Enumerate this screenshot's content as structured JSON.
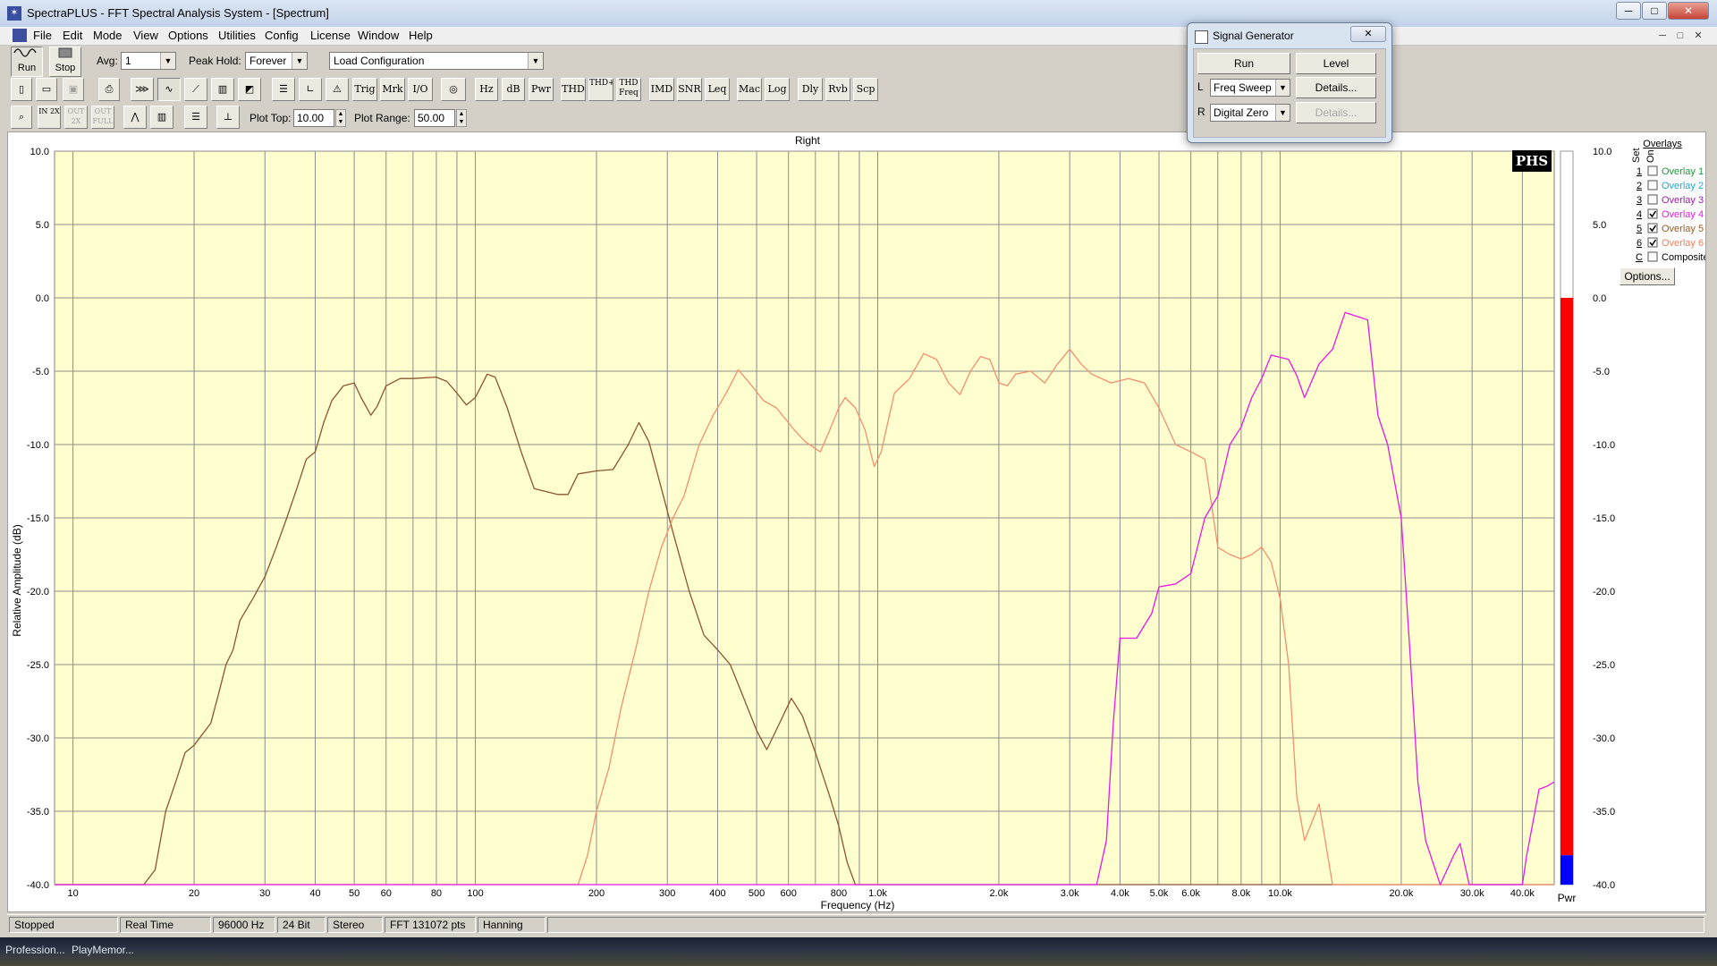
{
  "window": {
    "title": "SpectraPLUS - FFT Spectral Analysis System - [Spectrum]",
    "minimize_glyph": "─",
    "maximize_glyph": "□",
    "close_glyph": "✕"
  },
  "menu": {
    "items": [
      "File",
      "Edit",
      "Mode",
      "View",
      "Options",
      "Utilities",
      "Config",
      "License",
      "Window",
      "Help"
    ]
  },
  "toolbar1": {
    "run_label": "Run",
    "stop_label": "Stop",
    "avg_label": "Avg:",
    "avg_value": "1",
    "peak_hold_label": "Peak Hold:",
    "peak_hold_value": "Forever",
    "config_value": "Load Configuration"
  },
  "toolbar2": {
    "buttons": [
      "Trig",
      "Mrk",
      "I/O",
      "Hz",
      "dB",
      "Pwr",
      "THD",
      "THD+N",
      "THD Freq",
      "IMD",
      "SNR",
      "Leq",
      "Mac",
      "Log",
      "Dly",
      "Rvb",
      "Scp"
    ]
  },
  "toolbar3": {
    "zoom_in": "IN 2X",
    "zoom_out": "OUT 2X",
    "zoom_full": "OUT FULL",
    "plot_top_label": "Plot Top:",
    "plot_top_value": "10.00",
    "plot_range_label": "Plot Range:",
    "plot_range_value": "50.00"
  },
  "signal_generator": {
    "title": "Signal Generator",
    "close_glyph": "✕",
    "run_label": "Run",
    "level_label": "Level",
    "left_channel_label": "L",
    "left_signal": "Freq Sweep",
    "left_details": "Details...",
    "right_channel_label": "R",
    "right_signal": "Digital Zero",
    "right_details": "Details..."
  },
  "plot": {
    "channel_title": "Right",
    "logo": "PHS",
    "meter_label": "Pwr",
    "meter_level_db": -38.0,
    "meter_colors": {
      "red": "#ff0000",
      "blue": "#0000ff",
      "background": "#ffffff"
    }
  },
  "overlays": {
    "header": "Overlays",
    "set_label": "Set",
    "on_label": "On",
    "items": [
      {
        "key": "1",
        "name": "Overlay 1",
        "checked": false,
        "color": "#1c9a3c"
      },
      {
        "key": "2",
        "name": "Overlay 2",
        "checked": false,
        "color": "#20a7c9"
      },
      {
        "key": "3",
        "name": "Overlay 3",
        "checked": false,
        "color": "#9b1ca8"
      },
      {
        "key": "4",
        "name": "Overlay 4",
        "checked": true,
        "color": "#e619e6"
      },
      {
        "key": "5",
        "name": "Overlay 5",
        "checked": true,
        "color": "#9a5a20"
      },
      {
        "key": "6",
        "name": "Overlay 6",
        "checked": true,
        "color": "#f08058"
      },
      {
        "key": "C",
        "name": "Composite",
        "checked": false,
        "color": "#000000"
      }
    ],
    "options_label": "Options..."
  },
  "status": {
    "cells": [
      "Stopped",
      "Real Time",
      "96000 Hz",
      "24 Bit",
      "Stereo",
      "FFT 131072 pts",
      "Hanning"
    ]
  },
  "taskbar": {
    "items": [
      "Profession...",
      "PlayMemor..."
    ]
  },
  "chart_data": {
    "type": "line",
    "title": "Right",
    "xlabel": "Frequency (Hz)",
    "ylabel": "Relative Amplitude (dB)",
    "x_scale": "log",
    "xlim": [
      9,
      48000
    ],
    "ylim": [
      -40,
      10
    ],
    "grid": true,
    "background": "#fffecf",
    "x_tick_labels": [
      {
        "value": 10,
        "label": "10"
      },
      {
        "value": 20,
        "label": "20"
      },
      {
        "value": 30,
        "label": "30"
      },
      {
        "value": 40,
        "label": "40"
      },
      {
        "value": 50,
        "label": "50"
      },
      {
        "value": 60,
        "label": "60"
      },
      {
        "value": 80,
        "label": "80"
      },
      {
        "value": 100,
        "label": "100"
      },
      {
        "value": 200,
        "label": "200"
      },
      {
        "value": 300,
        "label": "300"
      },
      {
        "value": 400,
        "label": "400"
      },
      {
        "value": 500,
        "label": "500"
      },
      {
        "value": 600,
        "label": "600"
      },
      {
        "value": 800,
        "label": "800"
      },
      {
        "value": 1000,
        "label": "1.0k"
      },
      {
        "value": 2000,
        "label": "2.0k"
      },
      {
        "value": 3000,
        "label": "3.0k"
      },
      {
        "value": 4000,
        "label": "4.0k"
      },
      {
        "value": 5000,
        "label": "5.0k"
      },
      {
        "value": 6000,
        "label": "6.0k"
      },
      {
        "value": 8000,
        "label": "8.0k"
      },
      {
        "value": 10000,
        "label": "10.0k"
      },
      {
        "value": 20000,
        "label": "20.0k"
      },
      {
        "value": 30000,
        "label": "30.0k"
      },
      {
        "value": 40000,
        "label": "40.0k"
      }
    ],
    "x_gridlines": [
      10,
      20,
      30,
      40,
      50,
      60,
      70,
      80,
      90,
      100,
      200,
      300,
      400,
      500,
      600,
      700,
      800,
      900,
      1000,
      2000,
      3000,
      4000,
      5000,
      6000,
      7000,
      8000,
      9000,
      10000,
      20000,
      30000,
      40000
    ],
    "y_ticks": [
      {
        "value": 10,
        "label": "10.0"
      },
      {
        "value": 5,
        "label": "5.0"
      },
      {
        "value": 0,
        "label": "0.0"
      },
      {
        "value": -5,
        "label": "-5.0"
      },
      {
        "value": -10,
        "label": "-10.0"
      },
      {
        "value": -15,
        "label": "-15.0"
      },
      {
        "value": -20,
        "label": "-20.0"
      },
      {
        "value": -25,
        "label": "-25.0"
      },
      {
        "value": -30,
        "label": "-30.0"
      },
      {
        "value": -35,
        "label": "-35.0"
      },
      {
        "value": -40,
        "label": "-40.0"
      }
    ],
    "series": [
      {
        "color": "#8a5530",
        "points": [
          [
            9,
            -40
          ],
          [
            15,
            -40
          ],
          [
            16,
            -39
          ],
          [
            17,
            -35
          ],
          [
            18,
            -33
          ],
          [
            19,
            -31
          ],
          [
            20,
            -30.5
          ],
          [
            22,
            -29
          ],
          [
            23,
            -27
          ],
          [
            24,
            -25
          ],
          [
            25,
            -24
          ],
          [
            26,
            -22
          ],
          [
            28,
            -20.5
          ],
          [
            30,
            -19
          ],
          [
            32,
            -17
          ],
          [
            34,
            -15
          ],
          [
            36,
            -13
          ],
          [
            38,
            -11
          ],
          [
            40,
            -10.5
          ],
          [
            42,
            -8.5
          ],
          [
            44,
            -7
          ],
          [
            47,
            -6
          ],
          [
            50,
            -5.8
          ],
          [
            52,
            -6.8
          ],
          [
            55,
            -8
          ],
          [
            57,
            -7.4
          ],
          [
            60,
            -6
          ],
          [
            65,
            -5.5
          ],
          [
            70,
            -5.5
          ],
          [
            80,
            -5.4
          ],
          [
            85,
            -5.7
          ],
          [
            90,
            -6.5
          ],
          [
            95,
            -7.3
          ],
          [
            100,
            -6.8
          ],
          [
            107,
            -5.2
          ],
          [
            112,
            -5.4
          ],
          [
            120,
            -7.5
          ],
          [
            130,
            -10.5
          ],
          [
            140,
            -13
          ],
          [
            160,
            -13.4
          ],
          [
            170,
            -13.4
          ],
          [
            180,
            -12
          ],
          [
            200,
            -11.8
          ],
          [
            220,
            -11.7
          ],
          [
            240,
            -10
          ],
          [
            255,
            -8.5
          ],
          [
            270,
            -9.8
          ],
          [
            290,
            -13
          ],
          [
            310,
            -16
          ],
          [
            340,
            -20
          ],
          [
            370,
            -23
          ],
          [
            400,
            -24
          ],
          [
            430,
            -25
          ],
          [
            460,
            -27
          ],
          [
            500,
            -29.5
          ],
          [
            530,
            -30.8
          ],
          [
            570,
            -29
          ],
          [
            610,
            -27.3
          ],
          [
            650,
            -28.5
          ],
          [
            700,
            -31
          ],
          [
            760,
            -34
          ],
          [
            800,
            -36
          ],
          [
            840,
            -38.5
          ],
          [
            880,
            -40
          ],
          [
            48000,
            -40
          ]
        ]
      },
      {
        "color": "#f09070",
        "points": [
          [
            9,
            -40
          ],
          [
            180,
            -40
          ],
          [
            190,
            -38
          ],
          [
            200,
            -35
          ],
          [
            215,
            -32
          ],
          [
            230,
            -28
          ],
          [
            250,
            -24
          ],
          [
            270,
            -20
          ],
          [
            290,
            -17
          ],
          [
            310,
            -15
          ],
          [
            330,
            -13.5
          ],
          [
            360,
            -10
          ],
          [
            390,
            -8
          ],
          [
            420,
            -6.5
          ],
          [
            450,
            -4.9
          ],
          [
            480,
            -5.8
          ],
          [
            520,
            -7
          ],
          [
            560,
            -7.5
          ],
          [
            620,
            -9
          ],
          [
            660,
            -9.8
          ],
          [
            720,
            -10.5
          ],
          [
            760,
            -9
          ],
          [
            800,
            -7.5
          ],
          [
            830,
            -6.8
          ],
          [
            880,
            -7.5
          ],
          [
            930,
            -9
          ],
          [
            980,
            -11.5
          ],
          [
            1020,
            -10.5
          ],
          [
            1100,
            -6.5
          ],
          [
            1200,
            -5.5
          ],
          [
            1300,
            -3.8
          ],
          [
            1400,
            -4.2
          ],
          [
            1500,
            -5.8
          ],
          [
            1600,
            -6.6
          ],
          [
            1700,
            -5
          ],
          [
            1800,
            -4
          ],
          [
            1900,
            -4.2
          ],
          [
            2000,
            -5.8
          ],
          [
            2100,
            -6
          ],
          [
            2200,
            -5.2
          ],
          [
            2400,
            -5
          ],
          [
            2600,
            -5.8
          ],
          [
            2800,
            -4.5
          ],
          [
            3000,
            -3.5
          ],
          [
            3200,
            -4.5
          ],
          [
            3400,
            -5.2
          ],
          [
            3800,
            -5.8
          ],
          [
            4200,
            -5.5
          ],
          [
            4600,
            -5.8
          ],
          [
            5000,
            -7.5
          ],
          [
            5500,
            -10
          ],
          [
            6000,
            -10.5
          ],
          [
            6500,
            -11
          ],
          [
            7000,
            -17
          ],
          [
            7500,
            -17.5
          ],
          [
            8000,
            -17.8
          ],
          [
            8500,
            -17.5
          ],
          [
            9000,
            -17
          ],
          [
            9500,
            -18
          ],
          [
            10000,
            -20.5
          ],
          [
            10500,
            -25
          ],
          [
            11000,
            -34
          ],
          [
            11500,
            -37
          ],
          [
            12500,
            -34.5
          ],
          [
            13500,
            -40
          ],
          [
            48000,
            -40
          ]
        ]
      },
      {
        "color": "#e619e6",
        "points": [
          [
            9,
            -40
          ],
          [
            3500,
            -40
          ],
          [
            3700,
            -37
          ],
          [
            3850,
            -29
          ],
          [
            4000,
            -23.2
          ],
          [
            4400,
            -23.2
          ],
          [
            4800,
            -21.5
          ],
          [
            5000,
            -19.7
          ],
          [
            5500,
            -19.5
          ],
          [
            6000,
            -18.8
          ],
          [
            6500,
            -15
          ],
          [
            7000,
            -13.5
          ],
          [
            7500,
            -10
          ],
          [
            8000,
            -8.8
          ],
          [
            8500,
            -6.8
          ],
          [
            9000,
            -5.5
          ],
          [
            9500,
            -3.9
          ],
          [
            10500,
            -4.2
          ],
          [
            11000,
            -5.3
          ],
          [
            11500,
            -6.8
          ],
          [
            12500,
            -4.5
          ],
          [
            13500,
            -3.5
          ],
          [
            14500,
            -1
          ],
          [
            16500,
            -1.5
          ],
          [
            17500,
            -8
          ],
          [
            18500,
            -10
          ],
          [
            20000,
            -15
          ],
          [
            21000,
            -24
          ],
          [
            22000,
            -33
          ],
          [
            23000,
            -37
          ],
          [
            25000,
            -40
          ],
          [
            27000,
            -38
          ],
          [
            28000,
            -37.2
          ],
          [
            29500,
            -40
          ],
          [
            40000,
            -40
          ],
          [
            41000,
            -38
          ],
          [
            43000,
            -35
          ],
          [
            44000,
            -33.5
          ],
          [
            46000,
            -33.3
          ],
          [
            48000,
            -33
          ]
        ]
      }
    ]
  }
}
